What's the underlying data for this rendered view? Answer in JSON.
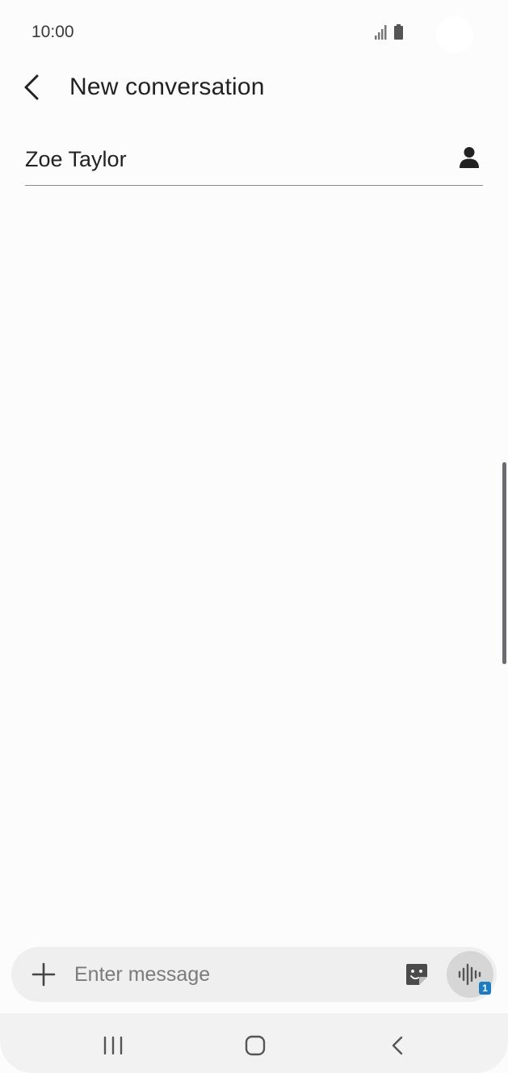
{
  "status_bar": {
    "time": "10:00",
    "signal_icon": "signal-icon",
    "battery_icon": "battery-icon"
  },
  "app_bar": {
    "back_icon": "chevron-left-icon",
    "title": "New conversation"
  },
  "recipient": {
    "name": "Zoe Taylor",
    "contact_icon": "person-icon"
  },
  "composer": {
    "add_icon": "plus-icon",
    "placeholder": "Enter message",
    "value": "",
    "sticker_icon": "sticker-icon",
    "voice_icon": "voice-wave-icon",
    "voice_badge": "1"
  },
  "nav_bar": {
    "recents_icon": "recents-icon",
    "home_icon": "home-icon",
    "back_icon": "back-icon"
  },
  "colors": {
    "background": "#fcfcfc",
    "composer": "#efefef",
    "badge": "#1a7cc3",
    "scroll_indicator": "#6b6b72"
  }
}
